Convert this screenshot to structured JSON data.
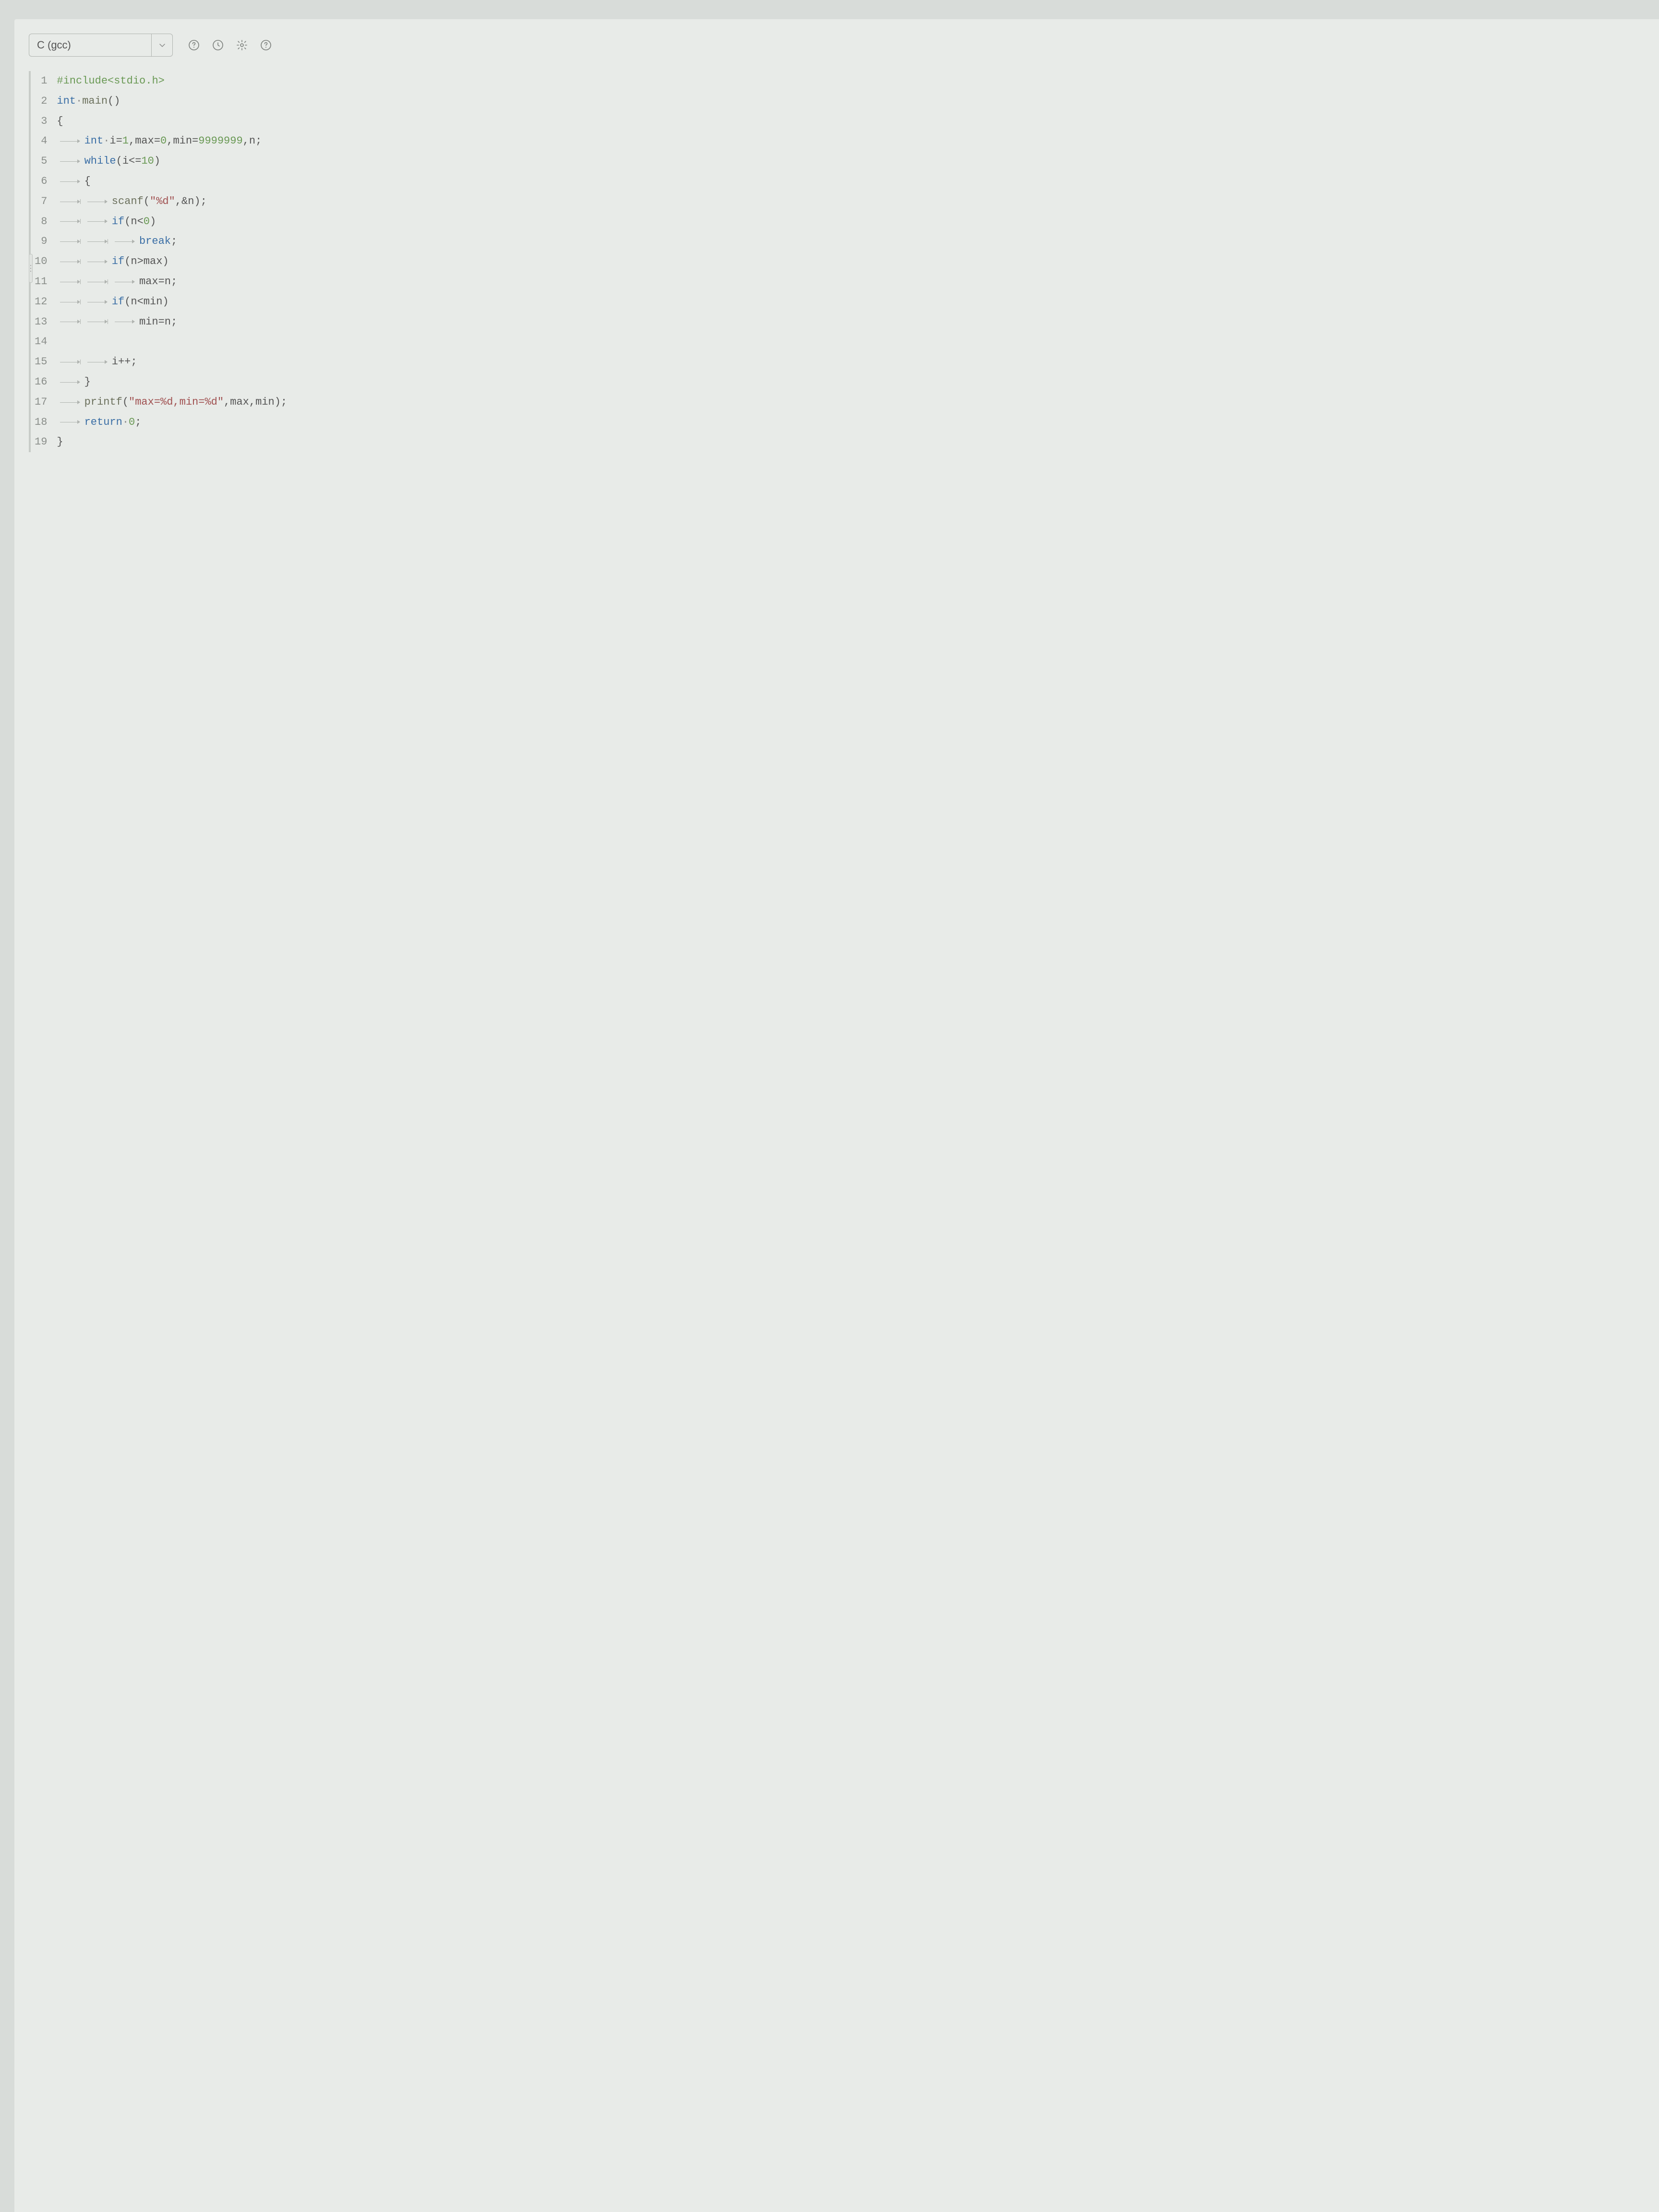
{
  "toolbar": {
    "language": "C (gcc)",
    "icons": [
      "question-circle-icon",
      "history-icon",
      "gear-icon",
      "help-icon"
    ]
  },
  "editor": {
    "lineCount": 19,
    "lines": [
      {
        "n": 1,
        "indent": 0,
        "tokens": [
          [
            "pp",
            "#include<stdio.h>"
          ]
        ]
      },
      {
        "n": 2,
        "indent": 0,
        "tokens": [
          [
            "kw",
            "int"
          ],
          [
            "dot",
            "·"
          ],
          [
            "fn",
            "main"
          ],
          [
            "op",
            "()"
          ]
        ]
      },
      {
        "n": 3,
        "indent": 0,
        "tokens": [
          [
            "op",
            "{"
          ]
        ]
      },
      {
        "n": 4,
        "indent": 1,
        "tokens": [
          [
            "kw",
            "int"
          ],
          [
            "dot",
            "·"
          ],
          [
            "id",
            "i="
          ],
          [
            "num",
            "1"
          ],
          [
            "op",
            ","
          ],
          [
            "id",
            "max="
          ],
          [
            "num",
            "0"
          ],
          [
            "op",
            ","
          ],
          [
            "id",
            "min="
          ],
          [
            "num",
            "9999999"
          ],
          [
            "op",
            ","
          ],
          [
            "id",
            "n"
          ],
          [
            "op",
            ";"
          ]
        ]
      },
      {
        "n": 5,
        "indent": 1,
        "tokens": [
          [
            "kw",
            "while"
          ],
          [
            "op",
            "("
          ],
          [
            "id",
            "i<="
          ],
          [
            "num",
            "10"
          ],
          [
            "op",
            ")"
          ]
        ]
      },
      {
        "n": 6,
        "indent": 1,
        "tokens": [
          [
            "op",
            "{"
          ]
        ]
      },
      {
        "n": 7,
        "indent": 2,
        "tokens": [
          [
            "fn",
            "scanf"
          ],
          [
            "op",
            "("
          ],
          [
            "str",
            "\"%d\""
          ],
          [
            "op",
            ","
          ],
          [
            "op",
            "&"
          ],
          [
            "id",
            "n"
          ],
          [
            "op",
            ");"
          ]
        ]
      },
      {
        "n": 8,
        "indent": 2,
        "tokens": [
          [
            "kw",
            "if"
          ],
          [
            "op",
            "("
          ],
          [
            "id",
            "n<"
          ],
          [
            "num",
            "0"
          ],
          [
            "op",
            ")"
          ]
        ]
      },
      {
        "n": 9,
        "indent": 3,
        "tokens": [
          [
            "kw",
            "break"
          ],
          [
            "op",
            ";"
          ]
        ]
      },
      {
        "n": 10,
        "indent": 2,
        "tokens": [
          [
            "kw",
            "if"
          ],
          [
            "op",
            "("
          ],
          [
            "id",
            "n>max"
          ],
          [
            "op",
            ")"
          ]
        ]
      },
      {
        "n": 11,
        "indent": 3,
        "tokens": [
          [
            "id",
            "max=n"
          ],
          [
            "op",
            ";"
          ]
        ]
      },
      {
        "n": 12,
        "indent": 2,
        "tokens": [
          [
            "kw",
            "if"
          ],
          [
            "op",
            "("
          ],
          [
            "id",
            "n<min"
          ],
          [
            "op",
            ")"
          ]
        ]
      },
      {
        "n": 13,
        "indent": 3,
        "tokens": [
          [
            "id",
            "min=n"
          ],
          [
            "op",
            ";"
          ]
        ]
      },
      {
        "n": 14,
        "indent": 0,
        "tokens": []
      },
      {
        "n": 15,
        "indent": 2,
        "tokens": [
          [
            "id",
            "i++"
          ],
          [
            "op",
            ";"
          ]
        ]
      },
      {
        "n": 16,
        "indent": 1,
        "tokens": [
          [
            "op",
            "}"
          ]
        ]
      },
      {
        "n": 17,
        "indent": 1,
        "tokens": [
          [
            "fn",
            "printf"
          ],
          [
            "op",
            "("
          ],
          [
            "str",
            "\"max=%d,min=%d\""
          ],
          [
            "op",
            ","
          ],
          [
            "id",
            "max"
          ],
          [
            "op",
            ","
          ],
          [
            "id",
            "min"
          ],
          [
            "op",
            ");"
          ]
        ]
      },
      {
        "n": 18,
        "indent": 1,
        "tokens": [
          [
            "kw",
            "return"
          ],
          [
            "dot",
            "·"
          ],
          [
            "num",
            "0"
          ],
          [
            "op",
            ";"
          ]
        ]
      },
      {
        "n": 19,
        "indent": 0,
        "tokens": [
          [
            "op",
            "}"
          ]
        ]
      }
    ]
  }
}
